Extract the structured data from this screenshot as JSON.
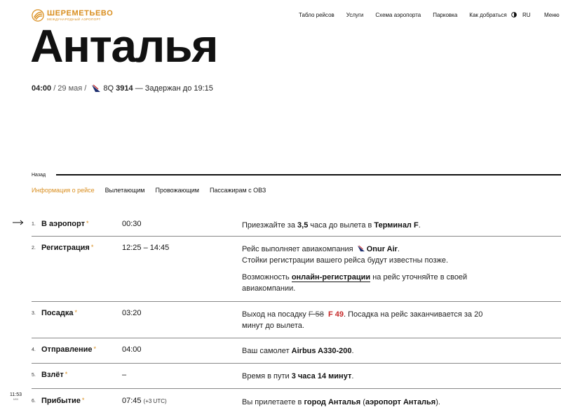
{
  "logo": {
    "name": "ШЕРЕМЕТЬЕВО",
    "subtitle": "МЕЖДУНАРОДНЫЙ АЭРОПОРТ"
  },
  "nav": {
    "items": [
      "Табло рейсов",
      "Услуги",
      "Схема аэропорта",
      "Парковка",
      "Как добраться"
    ],
    "lang": "RU",
    "menu": "Меню"
  },
  "flight": {
    "city": "Анталья",
    "time": "04:00",
    "date": " / 29 мая / ",
    "code_prefix": "8Q",
    "code_number": "3914",
    "status": " — Задержан до 19:15"
  },
  "back_label": "Назад",
  "tabs": [
    "Информация о рейсе",
    "Вылетающим",
    "Провожающим",
    "Пассажирам с ОВЗ"
  ],
  "steps": [
    {
      "num": "1.",
      "title": "В аэропорт",
      "time": "00:30",
      "desc": {
        "a": "Приезжайте за ",
        "b": "3,5",
        "c": " часа до вылета в ",
        "d": "Терминал F",
        "e": "."
      }
    },
    {
      "num": "2.",
      "title": "Регистрация",
      "time": "12:25 – 14:45",
      "desc": {
        "a": "Рейс выполняет авиакомпания ",
        "airline": "Onur Air",
        "b": ".",
        "c": "Стойки регистрации вашего рейса будут известны позже.",
        "d": "Возможность ",
        "link": "онлайн-регистрации",
        "e": " на рейс уточняйте в своей авиакомпании."
      }
    },
    {
      "num": "3.",
      "title": "Посадка",
      "time": "03:20",
      "desc": {
        "a": "Выход на посадку ",
        "old_gate": "F 58",
        "new_gate": "F 49",
        "b": ". Посадка на рейс заканчивается за 20 минут до вылета."
      }
    },
    {
      "num": "4.",
      "title": "Отправление",
      "time": "04:00",
      "desc": {
        "a": "Ваш самолет ",
        "b": "Airbus A330-200",
        "c": "."
      }
    },
    {
      "num": "5.",
      "title": "Взлёт",
      "time": "–",
      "desc": {
        "a": "Время в пути ",
        "b": "3 часа 14 минут",
        "c": "."
      }
    },
    {
      "num": "6.",
      "title": "Прибытие",
      "time": "07:45",
      "tz": "(+3 UTC)",
      "desc": {
        "a": "Вы прилетаете в ",
        "b": "город Анталья",
        "c": " (",
        "d": "аэропорт Анталья",
        "e": ")."
      }
    }
  ],
  "star": "*",
  "clock": {
    "time": "11:53",
    "sub": "MSK"
  },
  "colors": {
    "accent": "#d98e1f",
    "gate_new": "#c62828",
    "airline_logo": "#1e2f6f"
  }
}
